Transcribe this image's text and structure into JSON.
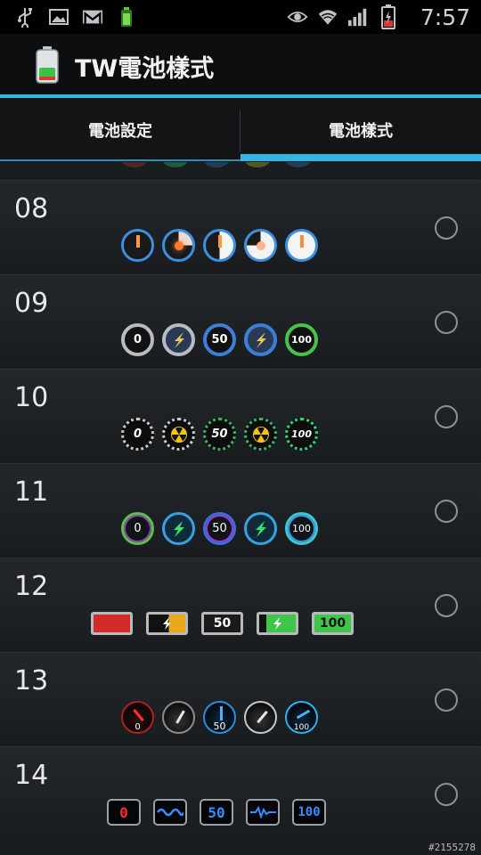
{
  "status_bar": {
    "time": "7:57",
    "left_icons": [
      "usb-icon",
      "image-icon",
      "gmail-icon",
      "battery-app-icon"
    ],
    "right_icons": [
      "eye-icon",
      "wifi-icon",
      "signal-icon",
      "battery-charging-icon"
    ]
  },
  "app": {
    "title": "TW電池樣式",
    "accent": "#33b5e5"
  },
  "tabs": [
    {
      "label": "電池設定",
      "selected": false
    },
    {
      "label": "電池樣式",
      "selected": true
    }
  ],
  "styles": [
    {
      "number": "08",
      "selected": false,
      "icon_set": "orange-dot-dials",
      "labels": [
        "",
        "",
        "",
        "",
        ""
      ]
    },
    {
      "number": "09",
      "selected": false,
      "icon_set": "metal-lightning-rings",
      "labels": [
        "0",
        "",
        "50",
        "",
        "100"
      ]
    },
    {
      "number": "10",
      "selected": false,
      "icon_set": "dotted-radiation-rings",
      "labels": [
        "0",
        "",
        "50",
        "",
        "100"
      ]
    },
    {
      "number": "11",
      "selected": false,
      "icon_set": "neon-lightning-rings",
      "labels": [
        "0",
        "",
        "50",
        "",
        "100"
      ]
    },
    {
      "number": "12",
      "selected": false,
      "icon_set": "battery-bars",
      "labels": [
        "",
        "",
        "50",
        "",
        "100"
      ]
    },
    {
      "number": "13",
      "selected": false,
      "icon_set": "speedometer-gauges",
      "labels": [
        "0",
        "",
        "50",
        "",
        "100"
      ]
    },
    {
      "number": "14",
      "selected": false,
      "icon_set": "lcd-digit-panels",
      "labels": [
        "0",
        "",
        "50",
        "",
        "100"
      ]
    }
  ],
  "watermark": "#2155278"
}
